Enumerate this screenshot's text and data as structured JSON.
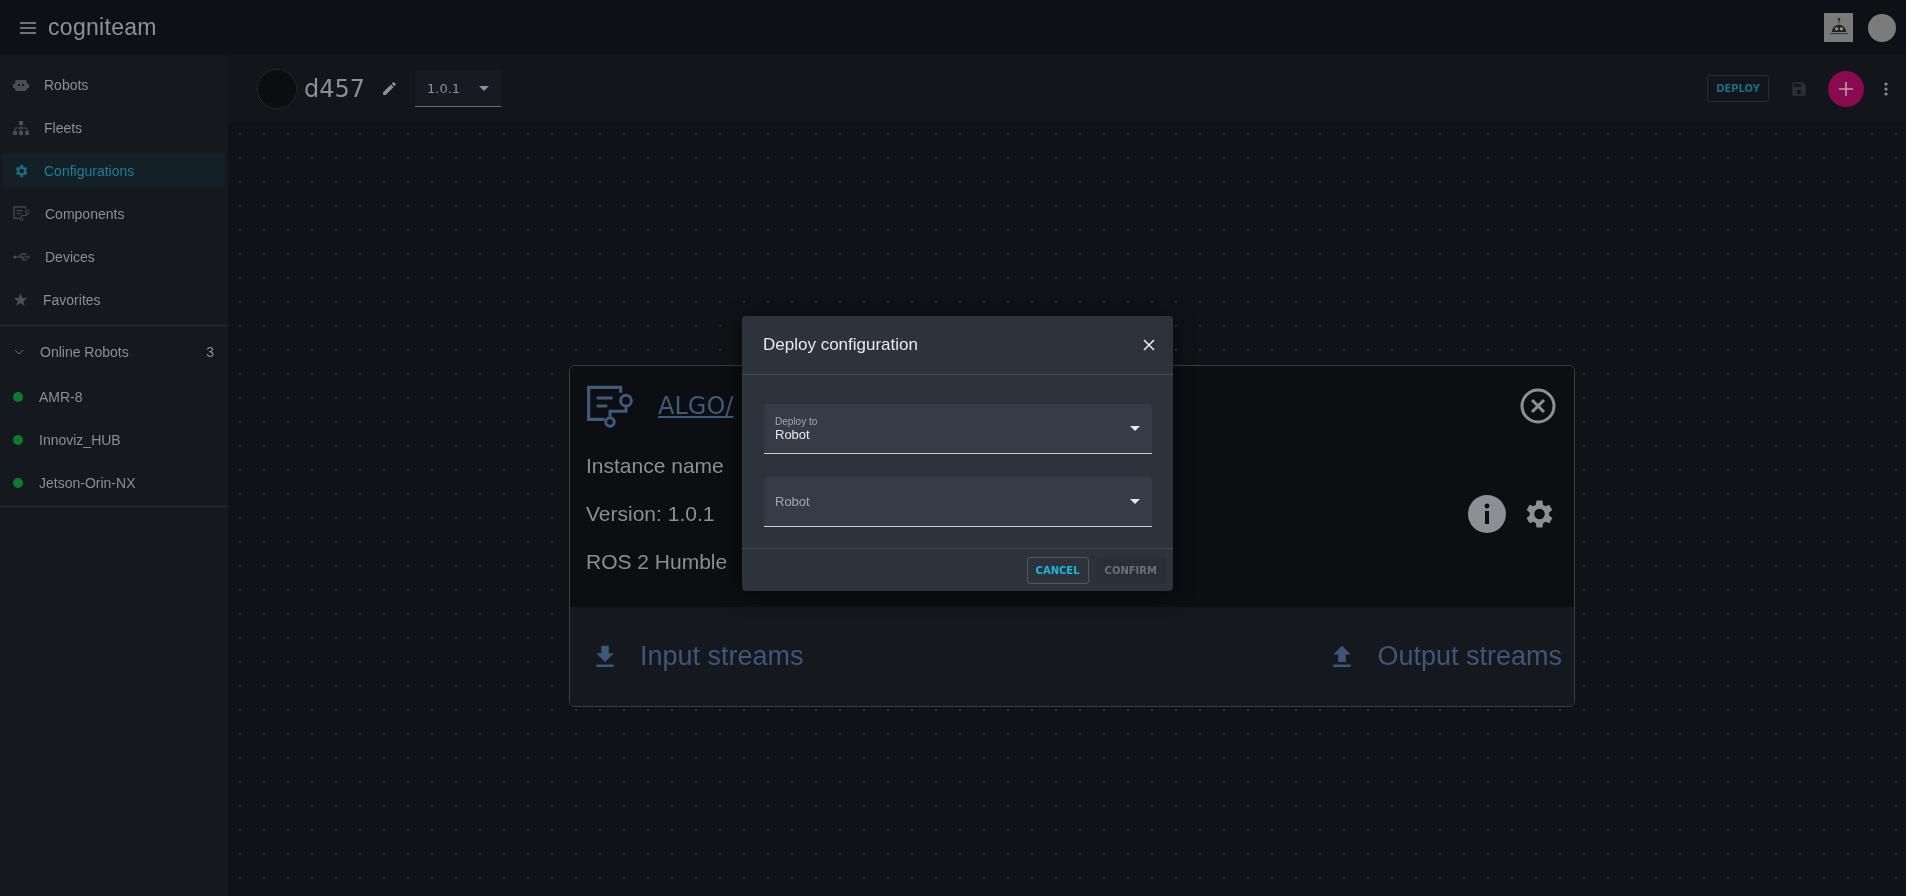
{
  "app_bar": {
    "logo": "cogniteam"
  },
  "sidebar": {
    "items": [
      {
        "label": "Robots",
        "selected": false
      },
      {
        "label": "Fleets",
        "selected": false
      },
      {
        "label": "Configurations",
        "selected": true
      },
      {
        "label": "Components",
        "selected": false
      },
      {
        "label": "Devices",
        "selected": false
      },
      {
        "label": "Favorites",
        "selected": false
      }
    ],
    "online_robots": {
      "label": "Online Robots",
      "count": "3",
      "expanded": true,
      "robots": [
        {
          "name": "AMR-8",
          "color": "#0e7a2e"
        },
        {
          "name": "Innoviz_HUB",
          "color": "#0e7a2e"
        },
        {
          "name": "Jetson-Orin-NX",
          "color": "#0e7a2e"
        }
      ]
    }
  },
  "header": {
    "title": "d457",
    "version": "1.0.1",
    "deploy_label": "DEPLOY"
  },
  "card": {
    "title": "ALGO/",
    "instance": "Instance name",
    "version": "Version: 1.0.1",
    "ros": "ROS 2 Humble",
    "input_streams": "Input streams",
    "output_streams": "Output streams"
  },
  "dialog": {
    "title": "Deploy configuration",
    "fields": [
      {
        "label": "Deploy to",
        "value": "Robot"
      },
      {
        "placeholder": "Robot"
      }
    ],
    "buttons": [
      {
        "label": "CANCEL",
        "disabled": false
      },
      {
        "label": "CONFIRM",
        "disabled": true
      }
    ]
  }
}
